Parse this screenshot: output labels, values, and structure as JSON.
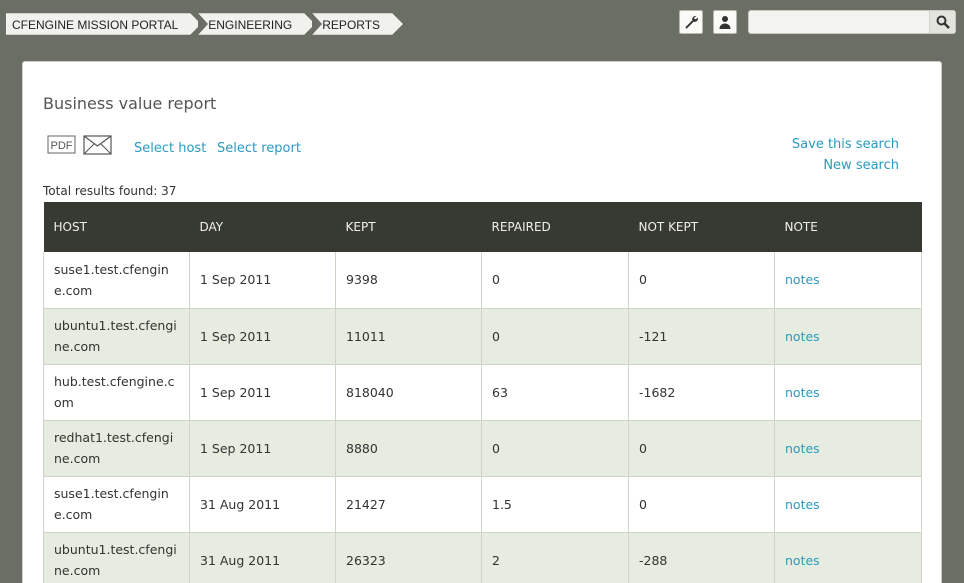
{
  "breadcrumb": [
    "CFENGINE MISSION PORTAL",
    "ENGINEERING",
    "REPORTS"
  ],
  "toolbar": {
    "settings_icon": "wrench-icon",
    "user_icon": "user-icon",
    "search_placeholder": "",
    "search_icon": "magnifier-icon"
  },
  "report": {
    "title": "Business value report",
    "pdf_label": "PDF",
    "select_host": "Select host",
    "select_report": "Select report",
    "save_search": "Save this search",
    "new_search": "New search",
    "total": "Total results found: 37"
  },
  "table": {
    "headers": [
      "HOST",
      "DAY",
      "KEPT",
      "REPAIRED",
      "NOT KEPT",
      "NOTE"
    ],
    "rows": [
      [
        "suse1.test.cfengine.com",
        "1 Sep 2011",
        "9398",
        "0",
        "0",
        "notes"
      ],
      [
        "ubuntu1.test.cfengine.com",
        "1 Sep 2011",
        "11011",
        "0",
        "-121",
        "notes"
      ],
      [
        "hub.test.cfengine.com",
        "1 Sep 2011",
        "818040",
        "63",
        "-1682",
        "notes"
      ],
      [
        "redhat1.test.cfengine.com",
        "1 Sep 2011",
        "8880",
        "0",
        "0",
        "notes"
      ],
      [
        "suse1.test.cfengine.com",
        "31 Aug 2011",
        "21427",
        "1.5",
        "0",
        "notes"
      ],
      [
        "ubuntu1.test.cfengine.com",
        "31 Aug 2011",
        "26323",
        "2",
        "-288",
        "notes"
      ]
    ]
  },
  "colors": {
    "background": "#6b6e65",
    "header": "#373a33",
    "alt_row": "#e6ecdf",
    "link": "#2a9ac0"
  }
}
